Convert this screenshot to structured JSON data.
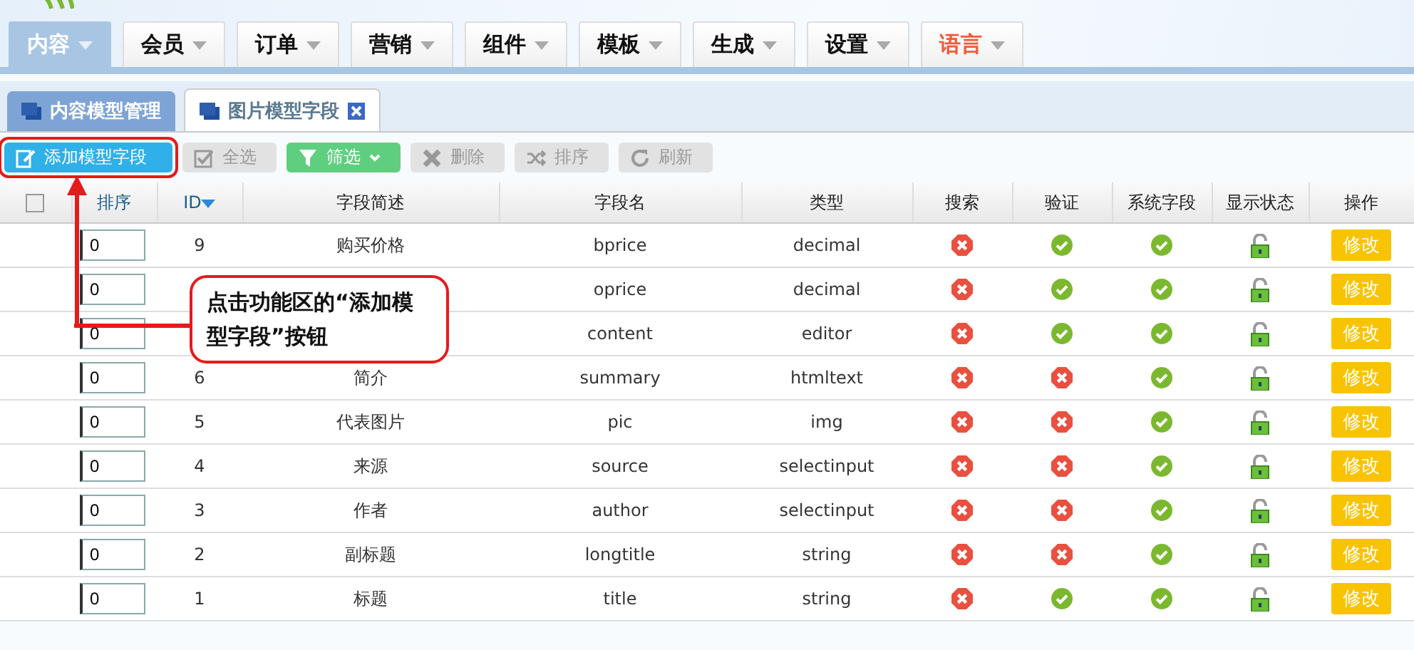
{
  "nav": [
    {
      "label": "内容",
      "selected": true,
      "highlight": false
    },
    {
      "label": "会员",
      "selected": false,
      "highlight": false
    },
    {
      "label": "订单",
      "selected": false,
      "highlight": false
    },
    {
      "label": "营销",
      "selected": false,
      "highlight": false
    },
    {
      "label": "组件",
      "selected": false,
      "highlight": false
    },
    {
      "label": "模板",
      "selected": false,
      "highlight": false
    },
    {
      "label": "生成",
      "selected": false,
      "highlight": false
    },
    {
      "label": "设置",
      "selected": false,
      "highlight": false
    },
    {
      "label": "语言",
      "selected": false,
      "highlight": true
    }
  ],
  "tabs": [
    {
      "label": "内容模型管理",
      "selected": false,
      "closable": false
    },
    {
      "label": "图片模型字段",
      "selected": true,
      "closable": true
    }
  ],
  "toolbar": [
    {
      "label": "添加模型字段",
      "kind": "add"
    },
    {
      "label": "全选",
      "kind": "checkall"
    },
    {
      "label": "筛选",
      "kind": "filter"
    },
    {
      "label": "删除",
      "kind": "delete"
    },
    {
      "label": "排序",
      "kind": "sort"
    },
    {
      "label": "刷新",
      "kind": "refresh"
    }
  ],
  "table": {
    "all_checked": false,
    "columns": [
      "排序",
      "ID",
      "字段简述",
      "字段名",
      "类型",
      "搜索",
      "验证",
      "系统字段",
      "显示状态",
      "操作"
    ],
    "rows": [
      {
        "order": "0",
        "id": "9",
        "desc": "购买价格",
        "name": "bprice",
        "type": "decimal",
        "search": false,
        "verify": true,
        "system": true,
        "action": "修改"
      },
      {
        "order": "0",
        "name": "oprice",
        "type": "decimal",
        "search": false,
        "verify": true,
        "system": true,
        "action": "修改"
      },
      {
        "order": "0",
        "name": "content",
        "type": "editor",
        "search": false,
        "verify": true,
        "system": true,
        "action": "修改"
      },
      {
        "order": "0",
        "id": "6",
        "desc": "简介",
        "name": "summary",
        "type": "htmltext",
        "search": false,
        "verify": false,
        "system": true,
        "action": "修改"
      },
      {
        "order": "0",
        "id": "5",
        "desc": "代表图片",
        "name": "pic",
        "type": "img",
        "search": false,
        "verify": false,
        "system": true,
        "action": "修改"
      },
      {
        "order": "0",
        "id": "4",
        "desc": "来源",
        "name": "source",
        "type": "selectinput",
        "search": false,
        "verify": false,
        "system": true,
        "action": "修改"
      },
      {
        "order": "0",
        "id": "3",
        "desc": "作者",
        "name": "author",
        "type": "selectinput",
        "search": false,
        "verify": false,
        "system": true,
        "action": "修改"
      },
      {
        "order": "0",
        "id": "2",
        "desc": "副标题",
        "name": "longtitle",
        "type": "string",
        "search": false,
        "verify": false,
        "system": true,
        "action": "修改"
      },
      {
        "order": "0",
        "id": "1",
        "desc": "标题",
        "name": "title",
        "type": "string",
        "search": false,
        "verify": true,
        "system": true,
        "action": "修改"
      }
    ]
  },
  "callout": {
    "text": "点击功能区的“添加模型字段”按钮"
  }
}
